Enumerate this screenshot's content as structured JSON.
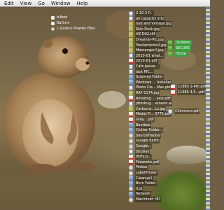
{
  "menubar": {
    "items": [
      "Edit",
      "View",
      "Go",
      "Window",
      "Help"
    ]
  },
  "desktop": {
    "top_left_items": [
      {
        "label": "bilbod",
        "icon": "folder"
      },
      {
        "label": "Bathrm",
        "icon": "folder"
      },
      {
        "label": "L Gallery Powder Files",
        "icon": "app"
      }
    ],
    "column_items": [
      {
        "label": "2-10-2 P...",
        "icon": "doc"
      },
      {
        "label": "air capacity info",
        "icon": "doc"
      },
      {
        "label": "Suit and Vintage.jpg",
        "icon": "img"
      },
      {
        "label": "Skin Desk.jpg",
        "icon": "img"
      },
      {
        "label": "HZ-D02.tiff",
        "icon": "img"
      },
      {
        "label": "Dreamer-Pic.jpg",
        "icon": "img"
      },
      {
        "label": "Preclemente2.jpg",
        "icon": "img"
      },
      {
        "label": "Messenger2.jpg",
        "icon": "img"
      },
      {
        "label": "2010-01 what...",
        "icon": "doc"
      },
      {
        "label": "2010-01.pdf",
        "icon": "pdf"
      },
      {
        "label": "Cats pause...",
        "icon": "doc"
      },
      {
        "label": "Jack PIC... ",
        "icon": "doc"
      },
      {
        "label": "Scanned Folder",
        "icon": "folder"
      },
      {
        "label": "Windows ... Installer",
        "icon": "folder"
      },
      {
        "label": "Photo Cle... Mac.pkt",
        "icon": "doc"
      },
      {
        "label": "RAF-1174.jpg",
        "icon": "img"
      },
      {
        "label": "Amazing ... sale.pdf",
        "icon": "pdf"
      },
      {
        "label": "Jitterbug... around.ai",
        "icon": "doc"
      },
      {
        "label": "Cartoons...Lo.jpg",
        "icon": "img"
      },
      {
        "label": "Medal.Pi... 0775.pdf",
        "icon": "pdf"
      },
      {
        "label": "Grey... pdf",
        "icon": "pdf"
      },
      {
        "label": "Bamboo",
        "icon": "folder"
      },
      {
        "label": "Clutter Folder...",
        "icon": "folder"
      },
      {
        "label": "SourceTracker",
        "icon": "app"
      },
      {
        "label": "Google Earth",
        "icon": "app"
      },
      {
        "label": "Google...",
        "icon": "app"
      },
      {
        "label": "Stickies",
        "icon": "doc"
      },
      {
        "label": "PDFs.b...",
        "icon": "pdf"
      },
      {
        "label": "Fireworks.pdf",
        "icon": "pdf"
      },
      {
        "label": "Pinbox",
        "icon": "app"
      },
      {
        "label": "LabelPrinter",
        "icon": "app"
      },
      {
        "label": "Cleanup1",
        "icon": "folder"
      },
      {
        "label": "Burn Folder",
        "icon": "folder"
      },
      {
        "label": "iCal",
        "icon": "app"
      },
      {
        "label": "Network",
        "icon": "folder"
      },
      {
        "label": "Macintosh HD",
        "icon": "app"
      }
    ],
    "green_badges": [
      "Updates",
      "SECURE",
      "Home"
    ],
    "side_right_items": [
      {
        "label": "11965 1-4th.pdf",
        "icon": "pdf"
      },
      {
        "label": "11965 4.5...pdf",
        "icon": "pdf"
      },
      {
        "label": "Chinmoun.pdf",
        "icon": "pdf"
      }
    ]
  }
}
